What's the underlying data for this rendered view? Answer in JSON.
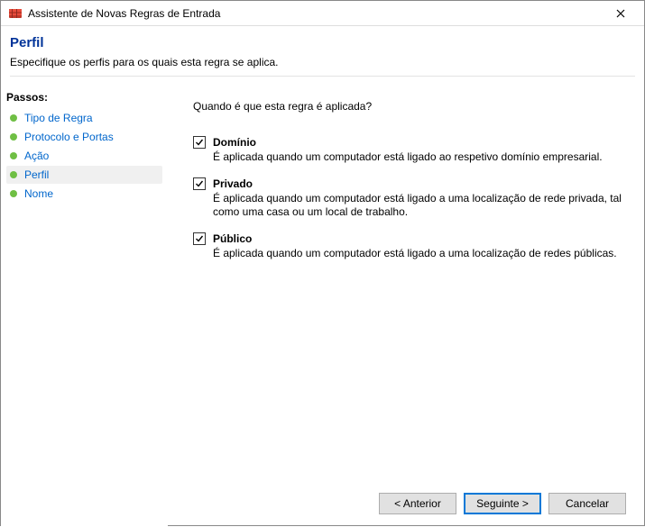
{
  "window": {
    "title": "Assistente de Novas Regras de Entrada"
  },
  "header": {
    "heading": "Perfil",
    "subheading": "Especifique os perfis para os quais esta regra se aplica."
  },
  "sidebar": {
    "label": "Passos:",
    "steps": [
      {
        "label": "Tipo de Regra",
        "current": false
      },
      {
        "label": "Protocolo e Portas",
        "current": false
      },
      {
        "label": "Ação",
        "current": false
      },
      {
        "label": "Perfil",
        "current": true
      },
      {
        "label": "Nome",
        "current": false
      }
    ]
  },
  "main": {
    "question": "Quando é que esta regra é aplicada?",
    "options": [
      {
        "label": "Domínio",
        "desc": "É aplicada quando um computador está ligado ao respetivo domínio empresarial.",
        "checked": true
      },
      {
        "label": "Privado",
        "desc": "É aplicada quando um computador está ligado a uma localização de rede privada, tal como uma casa ou um local de trabalho.",
        "checked": true
      },
      {
        "label": "Público",
        "desc": "É aplicada quando um computador está ligado a uma localização de redes públicas.",
        "checked": true
      }
    ]
  },
  "footer": {
    "back": "< Anterior",
    "next": "Seguinte >",
    "cancel": "Cancelar"
  }
}
